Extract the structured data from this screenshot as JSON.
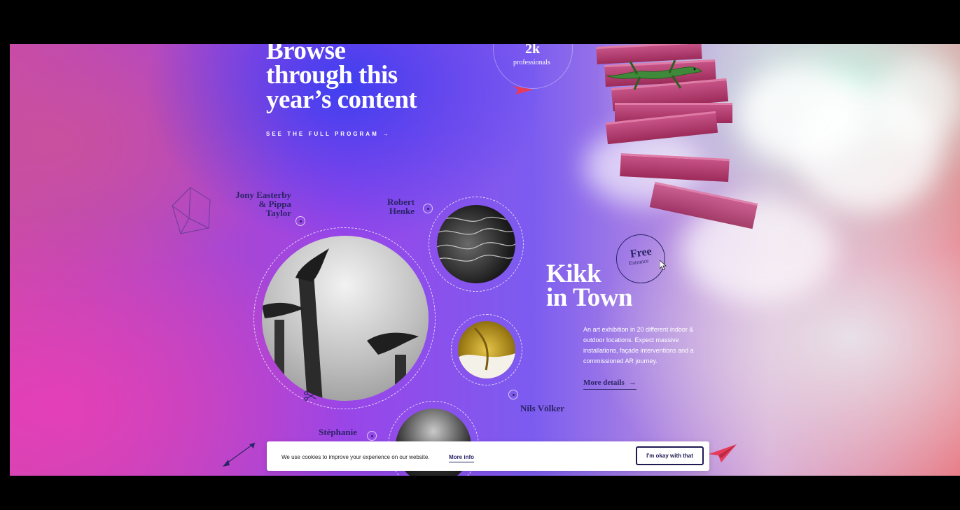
{
  "hero": {
    "title_lines": [
      "Browse",
      "through this",
      "year’s content"
    ],
    "program_link": "SEE THE FULL PROGRAM",
    "program_arrow": "→"
  },
  "stat": {
    "value": "2k",
    "label": "professionals"
  },
  "speakers": [
    {
      "name_lines": [
        "Jony Easterby",
        "& Pippa",
        "Taylor"
      ]
    },
    {
      "name_lines": [
        "Robert",
        "Henke"
      ]
    },
    {
      "name_lines": [
        "Nils Völker"
      ]
    },
    {
      "name_lines": [
        "Stéphanie"
      ]
    }
  ],
  "kikk": {
    "title_lines": [
      "Kikk",
      "in Town"
    ],
    "description": "An art exhibition in 20 different indoor & outdoor locations. Expect massive installations, façade interventions and a commissioned AR journey.",
    "more_label": "More details",
    "more_arrow": "→"
  },
  "free_badge": {
    "title": "Free",
    "subtitle": "Entrance"
  },
  "cookie": {
    "text": "We use cookies to improve your experience on our website.",
    "more_info": "More info",
    "accept": "I'm okay with that"
  },
  "colors": {
    "navy": "#2b2466",
    "accent_red": "#e63b5b",
    "white": "#ffffff"
  }
}
